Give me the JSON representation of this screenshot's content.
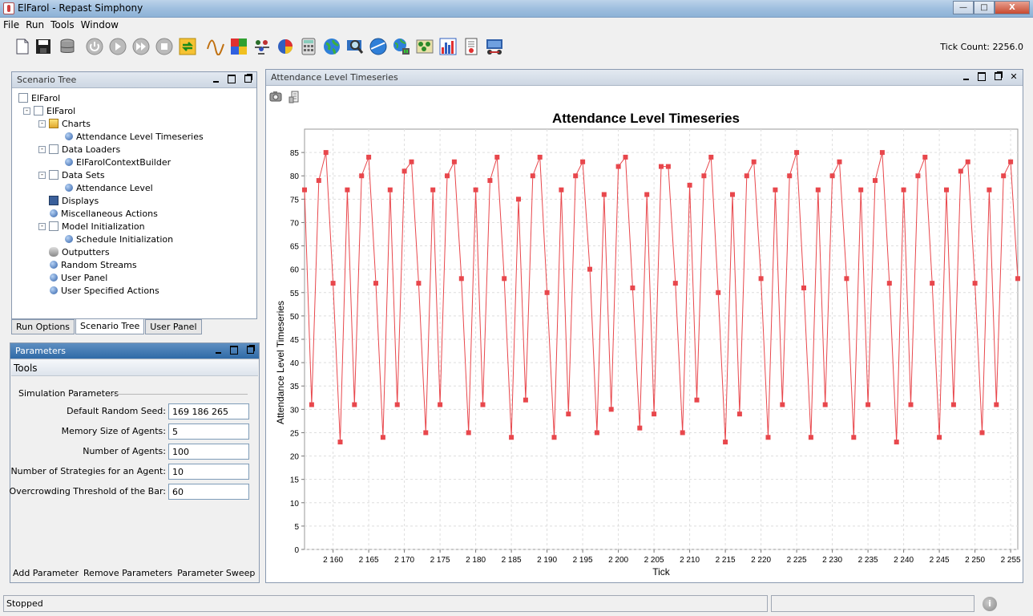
{
  "window": {
    "title": "ElFarol - Repast Simphony",
    "close_label": "X"
  },
  "menu": [
    "File",
    "Run",
    "Tools",
    "Window"
  ],
  "toolbar": {
    "tick_count": "Tick Count: 2256.0",
    "icons": [
      "new-scenario-icon",
      "save-icon",
      "database-icon",
      "init-icon",
      "start-icon",
      "step-icon",
      "stop-icon",
      "reset-icon",
      "timeseries-icon",
      "color-grid-icon",
      "agents-icon",
      "pie-chart-icon",
      "calculator-icon",
      "globe-icon",
      "magnifier-icon",
      "network-icon",
      "display-icon",
      "grid-icon",
      "histogram-icon",
      "report-icon",
      "batch-icon"
    ]
  },
  "scenario_tree": {
    "title": "Scenario Tree",
    "nodes": [
      {
        "label": "ElFarol",
        "icon": "doc"
      },
      {
        "label": "ElFarol",
        "icon": "doc"
      },
      {
        "label": "Charts",
        "icon": "folder"
      },
      {
        "label": "Attendance Level Timeseries",
        "icon": "dot"
      },
      {
        "label": "Data Loaders",
        "icon": "doc"
      },
      {
        "label": "ElFarolContextBuilder",
        "icon": "dot"
      },
      {
        "label": "Data Sets",
        "icon": "doc"
      },
      {
        "label": "Attendance Level",
        "icon": "dot"
      },
      {
        "label": "Displays",
        "icon": "monitor"
      },
      {
        "label": "Miscellaneous Actions",
        "icon": "dot"
      },
      {
        "label": "Model Initialization",
        "icon": "doc"
      },
      {
        "label": "Schedule Initialization",
        "icon": "dot"
      },
      {
        "label": "Outputters",
        "icon": "stack"
      },
      {
        "label": "Random Streams",
        "icon": "dot"
      },
      {
        "label": "User Panel",
        "icon": "dot"
      },
      {
        "label": "User Specified Actions",
        "icon": "dot"
      }
    ],
    "tabs": [
      "Run Options",
      "Scenario Tree",
      "User Panel"
    ]
  },
  "parameters": {
    "title": "Parameters",
    "tools_label": "Tools",
    "section_label": "Simulation Parameters",
    "fields": [
      {
        "label": "Default Random Seed:",
        "value": "169 186 265"
      },
      {
        "label": "Memory Size of Agents:",
        "value": "5"
      },
      {
        "label": "Number of Agents:",
        "value": "100"
      },
      {
        "label": "Number of Strategies for an Agent:",
        "value": "10"
      },
      {
        "label": "Overcrowding Threshold of the Bar:",
        "value": "60"
      }
    ],
    "links": [
      "Add Parameter",
      "Remove Parameters",
      "Parameter Sweep"
    ]
  },
  "chart_panel": {
    "title": "Attendance Level Timeseries"
  },
  "chart_data": {
    "type": "line",
    "title": "Attendance Level Timeseries",
    "xlabel": "Tick",
    "ylabel": "Attendance Level Timeseries",
    "x_start": 2156,
    "xlim": [
      2156,
      2256
    ],
    "ylim": [
      0,
      90
    ],
    "xticks": [
      2160,
      2165,
      2170,
      2175,
      2180,
      2185,
      2190,
      2195,
      2200,
      2205,
      2210,
      2215,
      2220,
      2225,
      2230,
      2235,
      2240,
      2245,
      2250,
      2255
    ],
    "yticks": [
      0,
      5,
      10,
      15,
      20,
      25,
      30,
      35,
      40,
      45,
      50,
      55,
      60,
      65,
      70,
      75,
      80,
      85
    ],
    "grid": true,
    "color": "#e8474c",
    "series": [
      {
        "values": [
          77,
          31,
          79,
          85,
          57,
          23,
          77,
          31,
          80,
          84,
          57,
          24,
          77,
          31,
          81,
          83,
          57,
          25,
          77,
          31,
          80,
          83,
          58,
          25,
          77,
          31,
          79,
          84,
          58,
          24,
          75,
          32,
          80,
          84,
          55,
          24,
          77,
          29,
          80,
          83,
          60,
          25,
          76,
          30,
          82,
          84,
          56,
          26,
          76,
          29,
          82,
          82,
          57,
          25,
          78,
          32,
          80,
          84,
          55,
          23,
          76,
          29,
          80,
          83,
          58,
          24,
          77,
          31,
          80,
          85,
          56,
          24,
          77,
          31,
          80,
          83,
          58,
          24,
          77,
          31,
          79,
          85,
          57,
          23,
          77,
          31,
          80,
          84,
          57,
          24,
          77,
          31,
          81,
          83,
          57,
          25,
          77,
          31,
          80,
          83,
          58
        ]
      }
    ]
  },
  "status": {
    "text": "Stopped",
    "icon": "info-icon",
    "icon_glyph": "i"
  }
}
